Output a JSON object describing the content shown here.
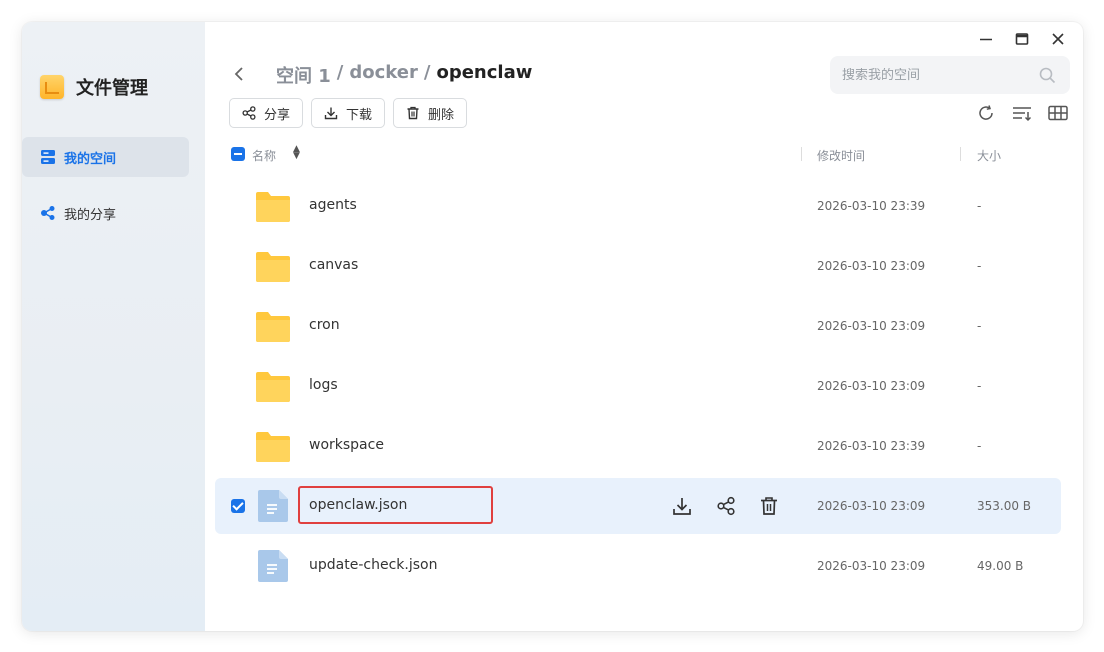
{
  "app": {
    "title": "文件管理"
  },
  "sidebar": {
    "items": [
      {
        "label": "我的空间",
        "icon": "storage-icon",
        "active": true
      },
      {
        "label": "我的分享",
        "icon": "share-icon",
        "active": false
      }
    ]
  },
  "breadcrumb": {
    "seg1": "空间 1",
    "sep1": "/",
    "seg2": "docker",
    "sep2": "/",
    "current": "openclaw"
  },
  "search": {
    "placeholder": "搜索我的空间"
  },
  "toolbar": {
    "share": "分享",
    "download": "下载",
    "delete": "删除"
  },
  "columns": {
    "name": "名称",
    "modified": "修改时间",
    "size": "大小"
  },
  "files": [
    {
      "name": "agents",
      "type": "folder",
      "modified": "2026-03-10 23:39",
      "size": "-"
    },
    {
      "name": "canvas",
      "type": "folder",
      "modified": "2026-03-10 23:09",
      "size": "-"
    },
    {
      "name": "cron",
      "type": "folder",
      "modified": "2026-03-10 23:09",
      "size": "-"
    },
    {
      "name": "logs",
      "type": "folder",
      "modified": "2026-03-10 23:09",
      "size": "-"
    },
    {
      "name": "workspace",
      "type": "folder",
      "modified": "2026-03-10 23:39",
      "size": "-"
    },
    {
      "name": "openclaw.json",
      "type": "file",
      "modified": "2026-03-10 23:09",
      "size": "353.00 B",
      "selected": true
    },
    {
      "name": "update-check.json",
      "type": "file",
      "modified": "2026-03-10 23:09",
      "size": "49.00 B"
    }
  ],
  "colors": {
    "accent": "#1a73e8",
    "folder": "#ffc83d",
    "file": "#a9c8ea",
    "highlight_border": "#e0403f",
    "selected_row": "#e8f1fc"
  }
}
